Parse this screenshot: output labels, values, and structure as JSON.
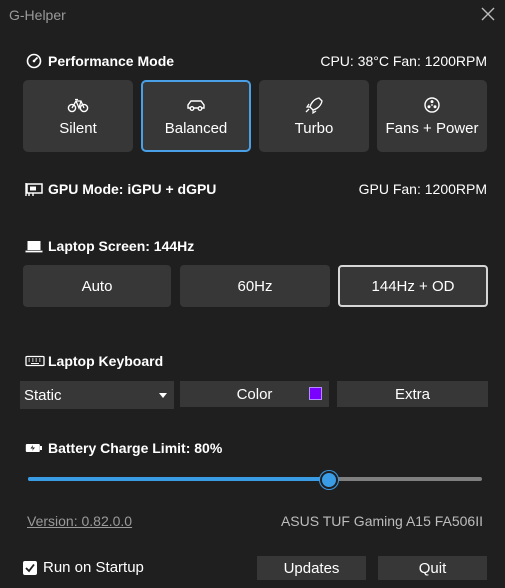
{
  "window": {
    "title": "G-Helper"
  },
  "performance": {
    "title": "Performance Mode",
    "cpu_info": "CPU: 38°C Fan: 1200RPM",
    "modes": [
      {
        "label": "Silent",
        "icon": "bicycle-icon",
        "active": false
      },
      {
        "label": "Balanced",
        "icon": "car-icon",
        "active": true
      },
      {
        "label": "Turbo",
        "icon": "rocket-icon",
        "active": false
      },
      {
        "label": "Fans + Power",
        "icon": "fan-icon",
        "active": false
      }
    ]
  },
  "gpu": {
    "title": "GPU Mode: iGPU + dGPU",
    "fan": "GPU Fan: 1200RPM",
    "icon": "gpu-card-icon"
  },
  "screen": {
    "title": "Laptop Screen: 144Hz",
    "icon": "laptop-icon",
    "options": [
      {
        "label": "Auto",
        "active": false
      },
      {
        "label": "60Hz",
        "active": false
      },
      {
        "label": "144Hz + OD",
        "active": true
      }
    ]
  },
  "keyboard": {
    "title": "Laptop Keyboard",
    "icon": "keyboard-icon",
    "mode_value": "Static",
    "color_label": "Color",
    "color_swatch": "#7a00ff",
    "extra_label": "Extra"
  },
  "battery": {
    "title": "Battery Charge Limit: 80%",
    "icon": "battery-icon",
    "limit_percent": 80,
    "slider_fill_fraction": 0.66
  },
  "footer": {
    "version": "Version: 0.82.0.0",
    "model": "ASUS TUF Gaming A15 FA506II",
    "run_on_startup_label": "Run on Startup",
    "run_on_startup_checked": true,
    "updates_label": "Updates",
    "quit_label": "Quit"
  },
  "colors": {
    "background": "#1f1f1f",
    "button": "#373737",
    "accent": "#3b9ce6"
  }
}
